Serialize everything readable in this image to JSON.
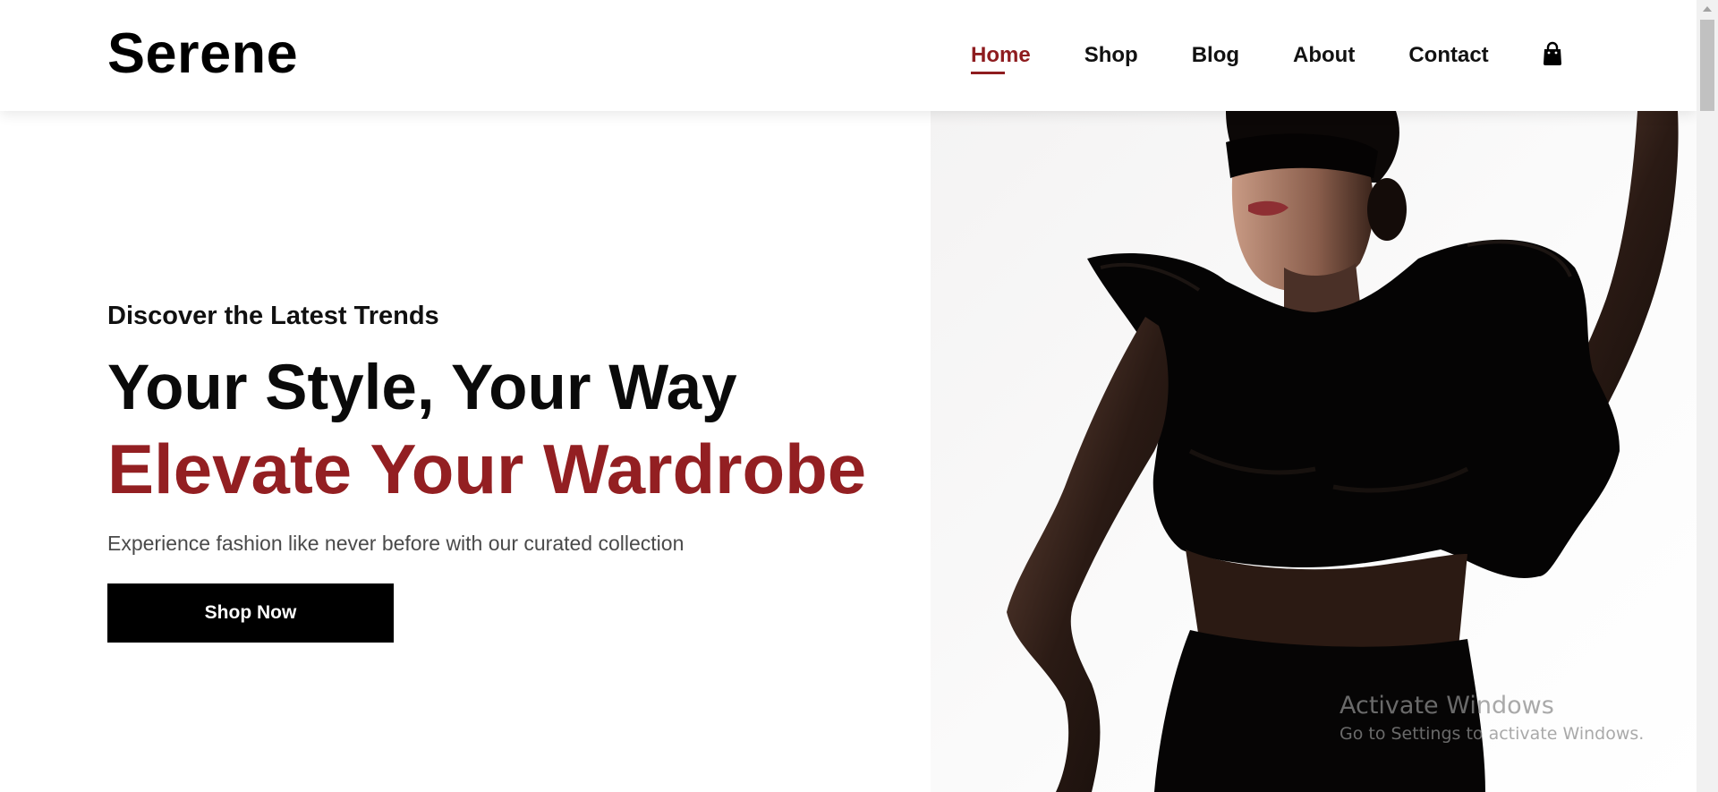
{
  "brand": {
    "name": "Serene",
    "accent_color": "#931f22"
  },
  "nav": {
    "items": [
      {
        "label": "Home",
        "active": true
      },
      {
        "label": "Shop",
        "active": false
      },
      {
        "label": "Blog",
        "active": false
      },
      {
        "label": "About",
        "active": false
      },
      {
        "label": "Contact",
        "active": false
      }
    ],
    "cart_icon": "shopping-bag-icon"
  },
  "hero": {
    "eyebrow": "Discover the Latest Trends",
    "headline_primary": "Your Style, Your Way",
    "headline_accent": "Elevate Your Wardrobe",
    "subtext": "Experience fashion like never before with our curated collection",
    "cta_label": "Shop Now",
    "image_alt": "hero-model-photo"
  },
  "system": {
    "watermark_title": "Activate Windows",
    "watermark_subtitle": "Go to Settings to activate Windows."
  }
}
